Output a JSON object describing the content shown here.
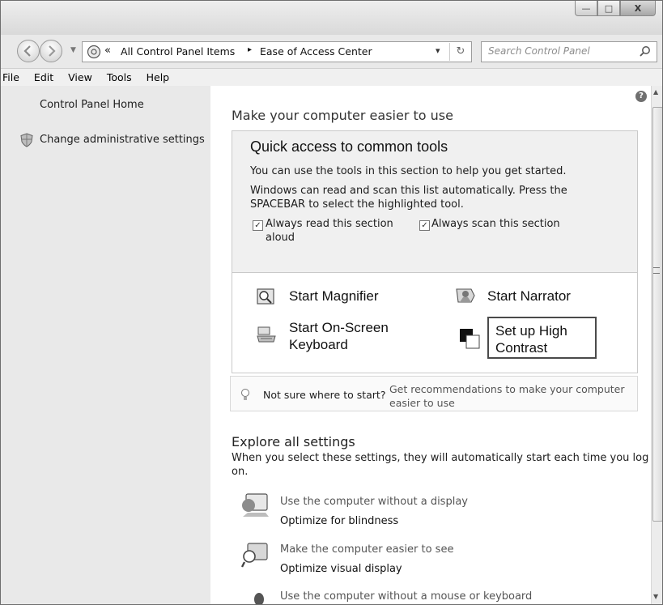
{
  "window": {
    "buttons": {
      "minimize": "—",
      "maximize": "□",
      "close": "X"
    }
  },
  "nav": {
    "back_icon": "back-arrow-icon",
    "forward_icon": "forward-arrow-icon",
    "address": {
      "chevron": "«",
      "crumbs": [
        "All Control Panel Items",
        "Ease of Access Center"
      ],
      "separator": "▸",
      "dropdown": "▾",
      "refresh": "↻"
    },
    "search": {
      "placeholder": "Search Control Panel"
    }
  },
  "menu": [
    "File",
    "Edit",
    "View",
    "Tools",
    "Help"
  ],
  "sidebar": {
    "home": "Control Panel Home",
    "admin": "Change administrative settings"
  },
  "main": {
    "help_icon": "?",
    "heading": "Make your computer easier to use",
    "quick": {
      "title": "Quick access to common tools",
      "line1": "You can use the tools in this section to help you get started.",
      "line2a": "Windows can read and scan this list automatically.  Press the",
      "line2b": "SPACEBAR to select the highlighted tool.",
      "read_aloud_a": "Always read this section",
      "read_aloud_b": "aloud",
      "scan": "Always scan this section",
      "read_aloud_checked": "✓",
      "scan_checked": "✓",
      "tools": {
        "magnifier": "Start Magnifier",
        "narrator": "Start Narrator",
        "osk_a": "Start On-Screen",
        "osk_b": "Keyboard",
        "contrast_a": "Set up High",
        "contrast_b": "Contrast"
      }
    },
    "hint": {
      "text": "Not sure where to start?",
      "link_a": "Get recommendations to make your computer",
      "link_b": "easier to use"
    },
    "explore": {
      "title": "Explore all settings",
      "desc_a": "When you select these settings, they will automatically start each time you log",
      "desc_b": "on.",
      "items": [
        {
          "title": "Use the computer without a display",
          "sub": "Optimize for blindness"
        },
        {
          "title": "Make the computer easier to see",
          "sub": "Optimize visual display"
        },
        {
          "title": "Use the computer without a mouse or keyboard",
          "sub": ""
        }
      ]
    }
  }
}
